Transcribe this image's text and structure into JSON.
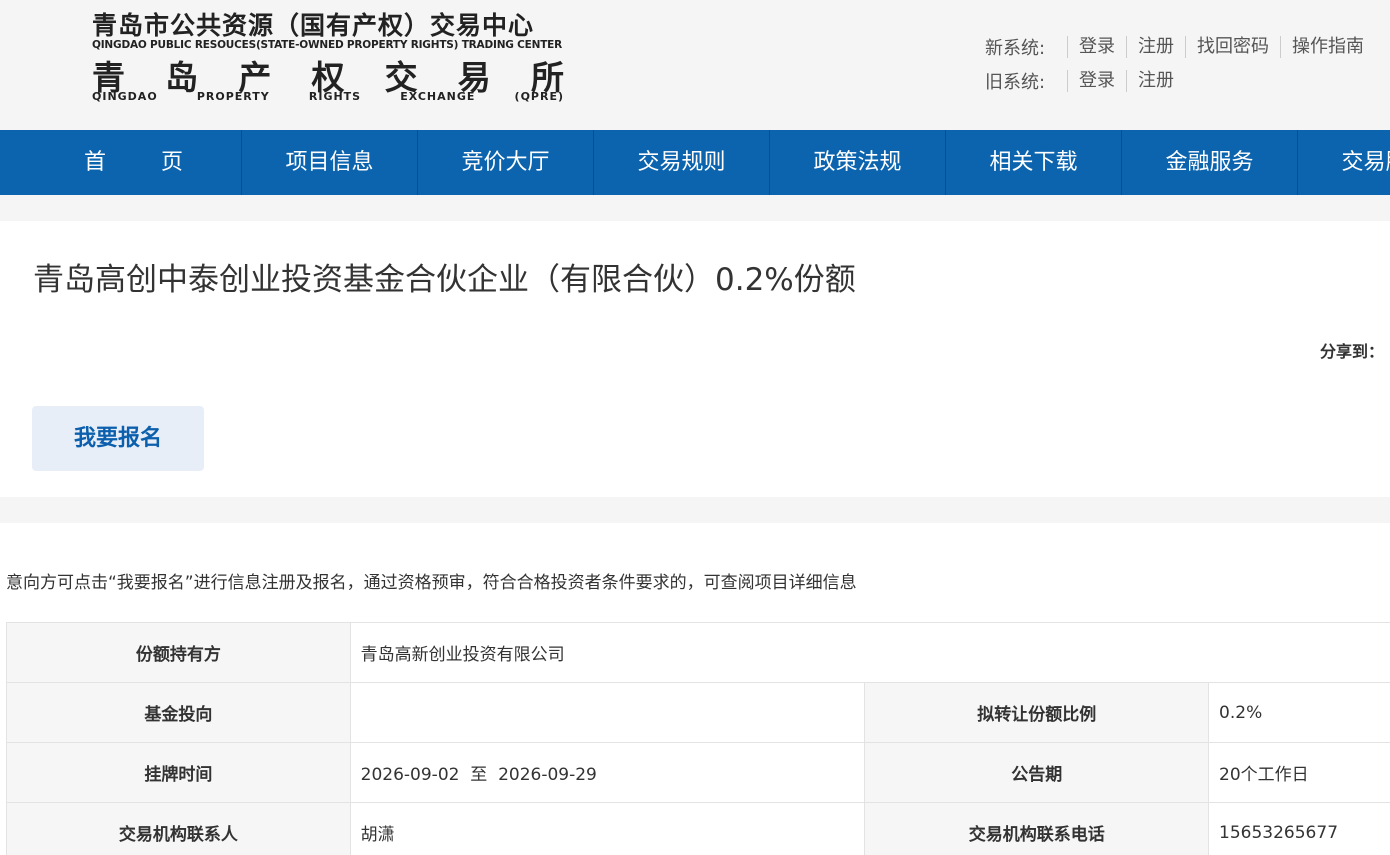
{
  "logo": {
    "cn_top": "青岛市公共资源（国有产权）交易中心",
    "en_top": "QINGDAO PUBLIC RESOUCES(STATE-OWNED PROPERTY RIGHTS) TRADING CENTER",
    "cn_big": [
      "青",
      "岛",
      "产",
      "权",
      "交",
      "易",
      "所"
    ],
    "en_bottom": [
      "QINGDAO",
      "PROPERTY",
      "RIGHTS",
      "EXCHANGE",
      "(QPRE)"
    ]
  },
  "systems": {
    "new_label": "新系统:",
    "new_links": [
      "登录",
      "注册",
      "找回密码",
      "操作指南"
    ],
    "old_label": "旧系统:",
    "old_links": [
      "登录",
      "注册"
    ]
  },
  "nav": [
    "首 页",
    "项目信息",
    "竞价大厅",
    "交易规则",
    "政策法规",
    "相关下载",
    "金融服务",
    "交易服务"
  ],
  "project": {
    "title": "青岛高创中泰创业投资基金合伙企业（有限合伙）0.2%份额",
    "share_label": "分享到：",
    "signup_button": "我要报名"
  },
  "notice": "意向方可点击“我要报名”进行信息注册及报名，通过资格预审，符合合格投资者条件要求的，可查阅项目详细信息",
  "table": {
    "holder_label": "份额持有方",
    "holder_value": "青岛高新创业投资有限公司",
    "fund_label": "基金投向",
    "fund_value": "",
    "ratio_label": "拟转让份额比例",
    "ratio_value": "0.2%",
    "listing_label": "挂牌时间",
    "listing_value": "2026-09-02  至  2026-09-29",
    "period_label": "公告期",
    "period_value": "20个工作日",
    "contact_label": "交易机构联系人",
    "contact_value": "胡潇",
    "phone_label": "交易机构联系电话",
    "phone_value": "15653265677"
  },
  "colors": {
    "nav_bg": "#0b64ad",
    "button_bg": "#e8eef8",
    "button_text": "#0b5fad",
    "page_bg": "#f5f5f5"
  }
}
